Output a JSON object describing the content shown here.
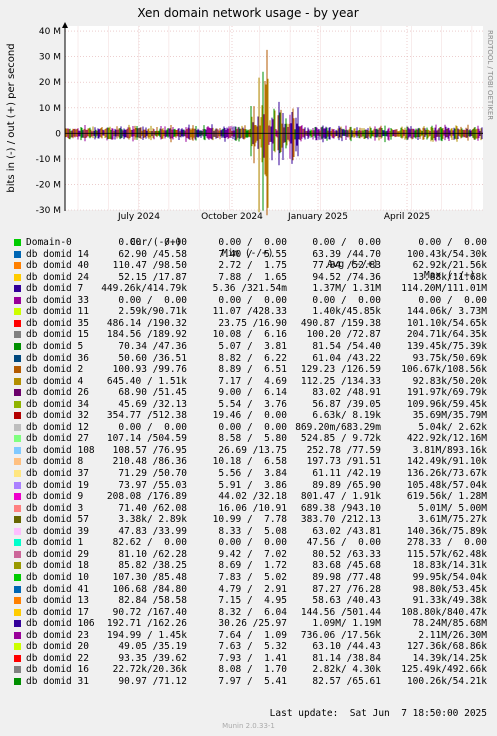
{
  "chart_data": {
    "type": "area",
    "title": "Xen domain network usage - by year",
    "ylabel": "bits in (-) / out (+) per second",
    "side_label": "RRDTOOL / TOBI OETIKER",
    "y_ticks": [
      "40 M",
      "30 M",
      "20 M",
      "10 M",
      "0",
      "-10 M",
      "-20 M",
      "-30 M"
    ],
    "y_values": [
      40,
      30,
      20,
      10,
      0,
      -10,
      -20,
      -30
    ],
    "ylim": [
      -30,
      42
    ],
    "x_ticks": [
      "July 2024",
      "October 2024",
      "January 2025",
      "April 2025"
    ],
    "grid": true
  },
  "legend": {
    "headers": {
      "cur": "Cur (-/+)",
      "min": "Min (-/+)",
      "avg": "Avg (-/+)",
      "max": "Max (-/+)"
    },
    "rows": [
      {
        "name": "Domain-0",
        "color": "#00cc00",
        "cur": "0.00 /  0.00",
        "min": "0.00 /  0.00",
        "avg": "0.00 /  0.00",
        "max": "0.00 /  0.00"
      },
      {
        "name": "db domid 14",
        "color": "#0066b3",
        "cur": "62.90 /45.58",
        "min": "7.40 /  5.55",
        "avg": "63.39 /44.70",
        "max": "100.43k/54.30k"
      },
      {
        "name": "db domid 40",
        "color": "#ff8000",
        "cur": "110.47 /98.50",
        "min": "2.72 /  1.75",
        "avg": "77.84 /52.83",
        "max": "62.92k/21.56k"
      },
      {
        "name": "db domid 24",
        "color": "#ffcc00",
        "cur": "52.15 /17.87",
        "min": "7.88 /  1.65",
        "avg": "94.52 /74.36",
        "max": "13.88k/11.68k"
      },
      {
        "name": "db domid 7",
        "color": "#330099",
        "cur": "449.26k/414.79k",
        "min": "5.36 /321.54m",
        "avg": "1.37M/ 1.31M",
        "max": "114.20M/111.01M"
      },
      {
        "name": "db domid 33",
        "color": "#990099",
        "cur": "0.00 /  0.00",
        "min": "0.00 /  0.00",
        "avg": "0.00 /  0.00",
        "max": "0.00 /  0.00"
      },
      {
        "name": "db domid 11",
        "color": "#ccff00",
        "cur": "2.59k/90.71k",
        "min": "11.07 /428.33",
        "avg": "1.40k/45.85k",
        "max": "144.06k/ 3.73M"
      },
      {
        "name": "db domid 35",
        "color": "#ff0000",
        "cur": "486.14 /190.32",
        "min": "23.75 /16.90",
        "avg": "490.87 /159.38",
        "max": "101.10k/54.65k"
      },
      {
        "name": "db domid 15",
        "color": "#808080",
        "cur": "184.56 /189.92",
        "min": "10.08 /  6.16",
        "avg": "100.20 /72.87",
        "max": "204.71k/64.35k"
      },
      {
        "name": "db domid 5",
        "color": "#008f00",
        "cur": "70.34 /47.36",
        "min": "5.07 /  3.81",
        "avg": "81.54 /54.40",
        "max": "139.45k/75.39k"
      },
      {
        "name": "db domid 36",
        "color": "#00487d",
        "cur": "50.60 /36.51",
        "min": "8.82 /  6.22",
        "avg": "61.04 /43.22",
        "max": "93.75k/50.69k"
      },
      {
        "name": "db domid 2",
        "color": "#b35a00",
        "cur": "100.93 /99.76",
        "min": "8.89 /  6.51",
        "avg": "129.23 /126.59",
        "max": "106.67k/108.56k"
      },
      {
        "name": "db domid 4",
        "color": "#b38f00",
        "cur": "645.40 / 1.51k",
        "min": "7.17 /  4.69",
        "avg": "112.25 /134.33",
        "max": "92.83k/50.20k"
      },
      {
        "name": "db domid 26",
        "color": "#6b006b",
        "cur": "68.90 /51.45",
        "min": "9.00 /  6.14",
        "avg": "83.02 /48.91",
        "max": "191.97k/69.79k"
      },
      {
        "name": "db domid 34",
        "color": "#8fb300",
        "cur": "45.69 /32.13",
        "min": "5.54 /  3.76",
        "avg": "56.87 /39.05",
        "max": "109.96k/59.45k"
      },
      {
        "name": "db domid 32",
        "color": "#b30000",
        "cur": "354.77 /512.38",
        "min": "19.46 /  0.00",
        "avg": "6.63k/ 8.19k",
        "max": "35.69M/35.79M"
      },
      {
        "name": "db domid 12",
        "color": "#bebebe",
        "cur": "0.00 /  0.00",
        "min": "0.00 /  0.00",
        "avg": "869.20m/683.29m",
        "max": "5.04k/ 2.62k"
      },
      {
        "name": "db domid 27",
        "color": "#80ff80",
        "cur": "107.14 /504.59",
        "min": "8.58 /  5.80",
        "avg": "524.85 / 9.72k",
        "max": "422.92k/12.16M"
      },
      {
        "name": "db domid 108",
        "color": "#80c9ff",
        "cur": "108.57 /76.95",
        "min": "26.69 /13.75",
        "avg": "252.78 /77.59",
        "max": "3.81M/893.16k"
      },
      {
        "name": "db domid 8",
        "color": "#ffc080",
        "cur": "210.48 /86.36",
        "min": "10.18 /  6.58",
        "avg": "197.73 /91.51",
        "max": "142.49k/91.10k"
      },
      {
        "name": "db domid 37",
        "color": "#ffe680",
        "cur": "71.29 /50.70",
        "min": "5.56 /  3.84",
        "avg": "61.11 /42.19",
        "max": "136.26k/73.67k"
      },
      {
        "name": "db domid 19",
        "color": "#aa80ff",
        "cur": "73.97 /55.03",
        "min": "5.91 /  3.86",
        "avg": "89.89 /65.90",
        "max": "105.48k/57.04k"
      },
      {
        "name": "db domid 9",
        "color": "#ee00cc",
        "cur": "208.08 /176.89",
        "min": "44.02 /32.18",
        "avg": "801.47 / 1.91k",
        "max": "619.56k/ 1.28M"
      },
      {
        "name": "db domid 3",
        "color": "#ff8080",
        "cur": "71.40 /62.08",
        "min": "16.06 /10.91",
        "avg": "689.38 /943.10",
        "max": "5.01M/ 5.00M"
      },
      {
        "name": "db domid 57",
        "color": "#666600",
        "cur": "3.38k/ 2.89k",
        "min": "10.99 /  7.78",
        "avg": "383.70 /212.13",
        "max": "3.61M/75.27k"
      },
      {
        "name": "db domid 39",
        "color": "#ffbfff",
        "cur": "47.83 /33.99",
        "min": "8.33 /  5.08",
        "avg": "63.02 /43.81",
        "max": "140.36k/75.89k"
      },
      {
        "name": "db domid 1",
        "color": "#00ffcc",
        "cur": "82.62 /  0.00",
        "min": "0.00 /  0.00",
        "avg": "47.56 /  0.00",
        "max": "278.33 /  0.00"
      },
      {
        "name": "db domid 29",
        "color": "#cc6699",
        "cur": "81.10 /62.28",
        "min": "9.42 /  7.02",
        "avg": "80.52 /63.33",
        "max": "115.57k/62.48k"
      },
      {
        "name": "db domid 18",
        "color": "#999900",
        "cur": "85.82 /38.25",
        "min": "8.69 /  1.72",
        "avg": "83.68 /45.68",
        "max": "18.83k/14.31k"
      },
      {
        "name": "db domid 10",
        "color": "#00cc00",
        "cur": "107.30 /85.48",
        "min": "7.83 /  5.02",
        "avg": "89.98 /77.48",
        "max": "99.95k/54.04k"
      },
      {
        "name": "db domid 41",
        "color": "#0066b3",
        "cur": "106.68 /84.80",
        "min": "4.79 /  2.91",
        "avg": "87.27 /76.28",
        "max": "98.80k/53.45k"
      },
      {
        "name": "db domid 13",
        "color": "#ff8000",
        "cur": "82.84 /58.58",
        "min": "7.15 /  4.95",
        "avg": "58.63 /40.43",
        "max": "91.33k/49.38k"
      },
      {
        "name": "db domid 17",
        "color": "#ffcc00",
        "cur": "90.72 /167.40",
        "min": "8.32 /  6.04",
        "avg": "144.56 /501.44",
        "max": "108.80k/840.47k"
      },
      {
        "name": "db domid 106",
        "color": "#330099",
        "cur": "192.71 /162.26",
        "min": "30.26 /25.97",
        "avg": "1.09M/ 1.19M",
        "max": "78.24M/85.68M"
      },
      {
        "name": "db domid 23",
        "color": "#990099",
        "cur": "194.99 / 1.45k",
        "min": "7.64 /  1.09",
        "avg": "736.06 /17.56k",
        "max": "2.11M/26.30M"
      },
      {
        "name": "db domid 20",
        "color": "#ccff00",
        "cur": "49.05 /35.19",
        "min": "7.63 /  5.32",
        "avg": "63.10 /44.43",
        "max": "127.36k/68.86k"
      },
      {
        "name": "db domid 22",
        "color": "#ff0000",
        "cur": "93.35 /39.62",
        "min": "7.93 /  1.41",
        "avg": "81.14 /38.84",
        "max": "14.39k/14.25k"
      },
      {
        "name": "db domid 16",
        "color": "#808080",
        "cur": "22.72k/20.36k",
        "min": "8.08 /  1.70",
        "avg": "2.82k/ 4.30k",
        "max": "125.49k/492.66k"
      },
      {
        "name": "db domid 31",
        "color": "#008f00",
        "cur": "90.97 /71.12",
        "min": "7.97 /  5.41",
        "avg": "82.57 /65.61",
        "max": "100.26k/54.21k"
      }
    ]
  },
  "footer": {
    "last_update": "Last update:  Sat Jun  7 18:50:00 2025",
    "munin": "Munin 2.0.33-1"
  }
}
